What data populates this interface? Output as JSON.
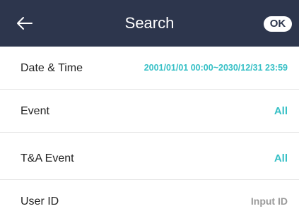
{
  "header": {
    "title": "Search",
    "ok_label": "OK"
  },
  "rows": [
    {
      "label": "Date & Time",
      "value": "2001/01/01 00:00~2030/12/31 23:59"
    },
    {
      "label": "Event",
      "value": "All"
    },
    {
      "label": "T&A Event",
      "value": "All"
    },
    {
      "label": "User ID",
      "placeholder": "Input ID"
    }
  ],
  "colors": {
    "header_bg": "#2d364d",
    "accent": "#36c0c6",
    "placeholder": "#9a9a9a"
  }
}
